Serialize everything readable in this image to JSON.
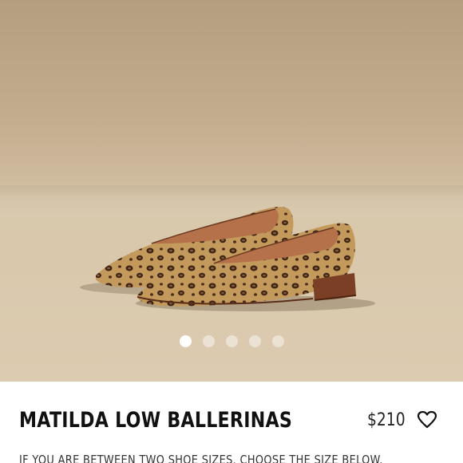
{
  "product": {
    "title": "MATILDA LOW BALLERINAS",
    "price": "$210",
    "size_note": "IF YOU ARE BETWEEN TWO SHOE SIZES, CHOOSE THE SIZE BELOW. OTHERWISE, CHOOSE YOUR USUAL SIZE."
  },
  "gallery": {
    "total_images": 5,
    "active_index": 0
  },
  "icons": {
    "favorite": "heart-icon"
  },
  "colors": {
    "background": "#ffffff",
    "text": "#111111",
    "shoe_sole": "#7a3f24",
    "leopard_base": "#c49a5c",
    "leopard_spot": "#3b2416"
  }
}
